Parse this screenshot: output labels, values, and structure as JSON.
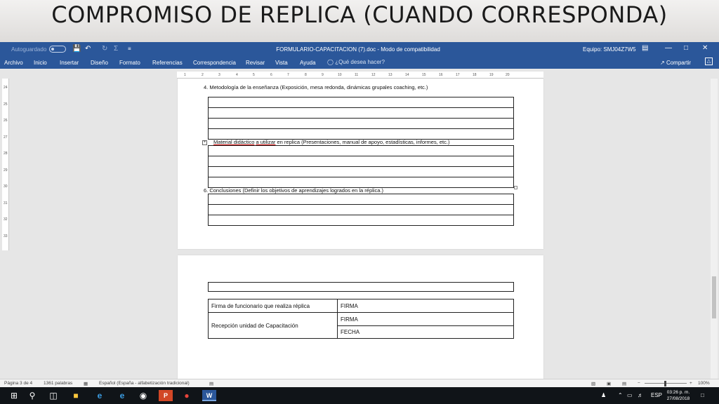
{
  "slide": {
    "title": "COMPROMISO DE REPLICA (CUANDO CORRESPONDA)"
  },
  "titlebar": {
    "autosave_label": "Autoguardado",
    "doc_title": "FORMULARIO-CAPACITACION (7).doc  -  Modo de compatibilidad",
    "account": "Equipo: SMJ04Z7W5",
    "icons": [
      "save-icon",
      "undo-icon",
      "redo-icon",
      "sum-icon",
      "customize-icon",
      "ribbon-display-icon",
      "minimize-icon",
      "maximize-icon",
      "close-icon"
    ]
  },
  "ribbon": {
    "tabs": [
      "Archivo",
      "Inicio",
      "Insertar",
      "Diseño",
      "Formato",
      "Referencias",
      "Correspondencia",
      "Revisar",
      "Vista",
      "Ayuda"
    ],
    "tell_me": "¿Qué desea hacer?",
    "share": "Compartir"
  },
  "ruler": {
    "h_ticks": [
      "1",
      "2",
      "3",
      "4",
      "5",
      "6",
      "7",
      "8",
      "9",
      "10",
      "11",
      "12",
      "13",
      "14",
      "15",
      "16",
      "17",
      "18",
      "19",
      "20"
    ],
    "v_ticks": [
      "24",
      "25",
      "26",
      "27",
      "28",
      "29",
      "30",
      "31",
      "32",
      "33"
    ]
  },
  "document": {
    "item4": "4.   Metodología de la enseñanza (Exposición, mesa redonda, dinámicas grupales coaching, etc.)",
    "item5_a": "Material didáctico",
    "item5_b": "a utilizar",
    "item5_c": "en replica (Presentaciones, manual de apoyo, estadísticas, informes, etc.)",
    "item6": "6.   Conclusiones (Definir los objetivos de aprendizajes logrados en la réplica.)",
    "signature_table": {
      "row1_label": "Firma de funcionario que realiza réplica",
      "row1_value": "FIRMA",
      "row2_label": "Recepción unidad de Capacitación",
      "row2_value": "FIRMA",
      "row3_value": "FECHA"
    }
  },
  "statusbar": {
    "page": "Página 3 de 4",
    "words": "1361 palabras",
    "language": "Español (España - alfabetización tradicional)",
    "zoom": "100%"
  },
  "taskbar": {
    "lang": "ESP",
    "time": "03:26 p. m.",
    "date": "27/08/2018"
  }
}
